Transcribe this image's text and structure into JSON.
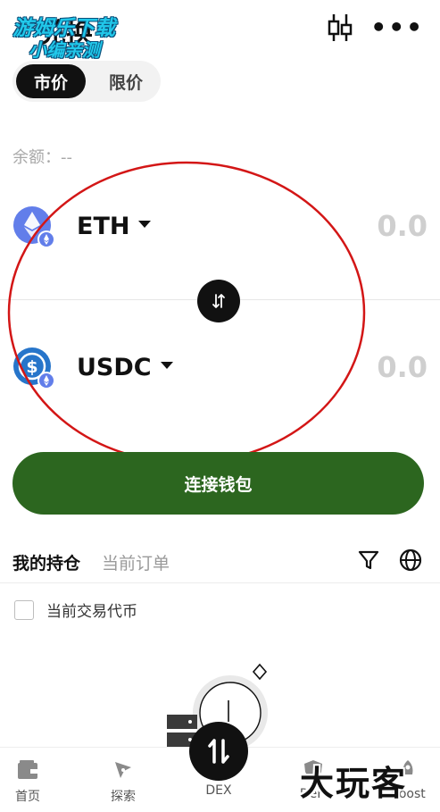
{
  "header": {
    "title_partial": "兑换",
    "watermark_line1": "游姆乐下载",
    "watermark_line2": "小编亲测",
    "candlestick_icon": "candlestick-chart-icon",
    "more_icon": "more-horizontal-icon",
    "more_glyph": "•••"
  },
  "order_type": {
    "tabs": [
      {
        "label": "市价",
        "active": true
      },
      {
        "label": "限价",
        "active": false
      }
    ]
  },
  "balance": {
    "label": "余额：--"
  },
  "swap": {
    "from": {
      "symbol": "ETH",
      "amount": "0.0",
      "icon": "eth-token-icon"
    },
    "to": {
      "symbol": "USDC",
      "amount": "0.0",
      "icon": "usdc-token-icon"
    },
    "swap_icon": "swap-direction-icon"
  },
  "connect_button": {
    "label": "连接钱包"
  },
  "positions": {
    "tabs": [
      {
        "label": "我的持仓",
        "active": true
      },
      {
        "label": "当前订单",
        "active": false
      }
    ],
    "filter_icon": "filter-icon",
    "globe_icon": "globe-icon",
    "checkbox_label": "当前交易代币"
  },
  "bottom_nav": {
    "items": [
      {
        "label": "首页",
        "icon": "wallet-icon"
      },
      {
        "label": "探索",
        "icon": "compass-icon"
      },
      {
        "label": "DEX",
        "icon": "swap-icon"
      },
      {
        "label": "DeFi",
        "icon": "shield-icon"
      },
      {
        "label": "Boost",
        "icon": "rocket-icon"
      }
    ]
  },
  "site_watermark": "大玩客",
  "colors": {
    "primary_green": "#2c661f",
    "annotation_red": "#d31616",
    "eth_blue": "#627eea",
    "usdc_blue": "#2775ca"
  }
}
